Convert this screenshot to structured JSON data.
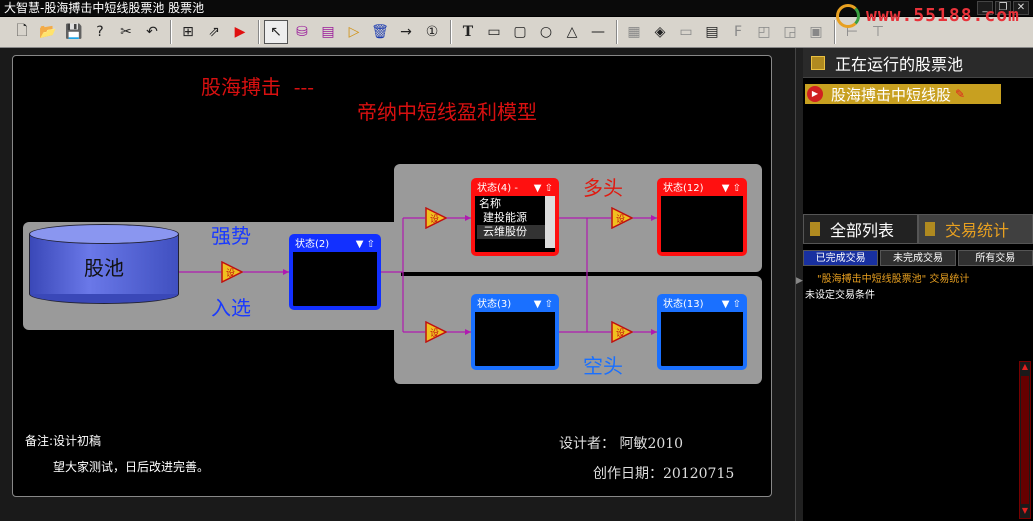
{
  "window": {
    "title": "大智慧-股海搏击中短线股票池  股票池",
    "buttons": [
      "_",
      "❐",
      "✕"
    ]
  },
  "logo": {
    "text": "www.55188.com"
  },
  "toolbar": {
    "icons": [
      "new-icon",
      "open-icon",
      "save-icon",
      "properties-icon",
      "cut-icon",
      "undo-icon",
      "tree-icon",
      "export-icon",
      "run-icon",
      "pointer-icon",
      "database-icon",
      "list-icon",
      "amplifier-icon",
      "delete-icon",
      "arrow-icon",
      "link-icon",
      "text-icon",
      "rectangle-icon",
      "rounded-rect-icon",
      "circle-icon",
      "triangle-icon",
      "line-icon"
    ],
    "text_tool": "T"
  },
  "diagram": {
    "title1": "股海搏击  ---",
    "title2": "帝纳中短线盈利模型",
    "pool_label": "股池",
    "strong_label": "强势",
    "select_label": "入选",
    "bull_label": "多头",
    "bear_label": "空头",
    "state2": {
      "title": "状态(2)",
      "controls": "▼ ⇧"
    },
    "state4": {
      "title": "状态(4) -",
      "controls": "▼ ⇧",
      "column": "名称",
      "stocks": [
        "建投能源",
        "云维股份"
      ]
    },
    "state12": {
      "title": "状态(12)",
      "controls": "▼ ⇧"
    },
    "state3": {
      "title": "状态(3)",
      "controls": "▼ ⇧"
    },
    "state13": {
      "title": "状态(13)",
      "controls": "▼ ⇧"
    },
    "amp_label": "设",
    "note1": "备注:设计初稿",
    "note2": "望大家测试，日后改进完善。",
    "designer": "设计者：  阿敏2010",
    "created": "创作日期：20120715"
  },
  "right_panel": {
    "running_header": "正在运行的股票池",
    "running_item": "股海搏击中短线股",
    "tab_all": "全部列表",
    "tab_stats": "交易统计",
    "sub_done": "已完成交易",
    "sub_undone": "未完成交易",
    "sub_all": "所有交易",
    "stats_title": "\"股海搏击中短线股票池\" 交易统计",
    "stats_msg": "未设定交易条件"
  }
}
